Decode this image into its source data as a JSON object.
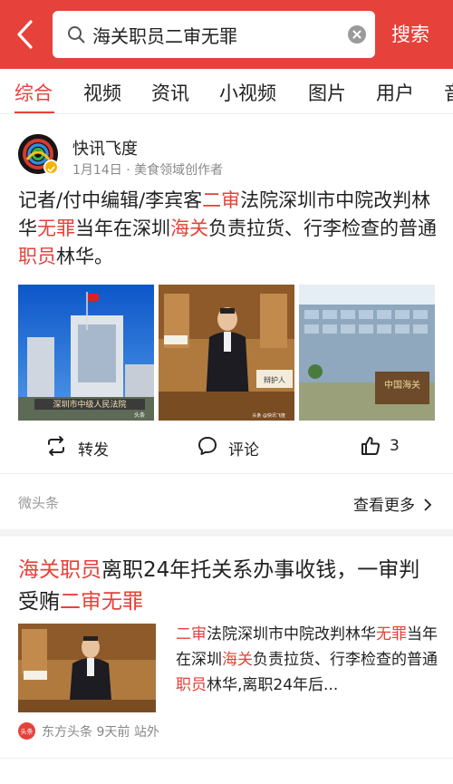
{
  "search": {
    "query": "海关职员二审无罪",
    "button_label": "搜索"
  },
  "tabs": [
    "综合",
    "视频",
    "资讯",
    "小视频",
    "图片",
    "用户",
    "音"
  ],
  "active_tab": "综合",
  "card1": {
    "author": "快讯飞度",
    "date": "1月14日",
    "separator": "·",
    "author_tag": "美食领域创作者",
    "headline_parts": [
      {
        "t": "记者/付中编辑/李宾客",
        "hl": false
      },
      {
        "t": "二审",
        "hl": true
      },
      {
        "t": "法院深圳市中院改判林华",
        "hl": false
      },
      {
        "t": "无罪",
        "hl": true
      },
      {
        "t": "当年在深圳",
        "hl": false
      },
      {
        "t": "海关",
        "hl": true
      },
      {
        "t": "负责拉货、行李检查的普通",
        "hl": false
      },
      {
        "t": "职员",
        "hl": true
      },
      {
        "t": "林华。",
        "hl": false
      }
    ],
    "images": [
      {
        "caption": "深圳市中级人民法院",
        "watermark": "头条"
      },
      {
        "caption": "辩护人",
        "watermark": "头条 @快讯飞度"
      },
      {
        "caption": "中国海关",
        "watermark": ""
      }
    ],
    "actions": {
      "repost": "转发",
      "comment": "评论",
      "like_count": "3"
    },
    "source_label": "微头条",
    "see_more": "查看更多"
  },
  "card2": {
    "title_parts": [
      {
        "t": "海关职员",
        "hl": true
      },
      {
        "t": "离职24年托关系办事收钱，一审判受贿",
        "hl": false
      },
      {
        "t": "二审无罪",
        "hl": true
      }
    ],
    "snippet_parts": [
      {
        "t": "二审",
        "hl": true
      },
      {
        "t": "法院深圳市中院改判林华",
        "hl": false
      },
      {
        "t": "无罪",
        "hl": true
      },
      {
        "t": "当年在深圳",
        "hl": false
      },
      {
        "t": "海关",
        "hl": true
      },
      {
        "t": "负责拉货、行李检查的普通",
        "hl": false
      },
      {
        "t": "职员",
        "hl": true
      },
      {
        "t": "林华,离职24年后...",
        "hl": false
      }
    ],
    "source": "东方头条",
    "time": "9天前",
    "site_tag": "站外",
    "source_icon_text": "头条"
  },
  "colors": {
    "accent": "#e6413a",
    "muted": "#888888"
  },
  "icons": [
    "back-arrow-icon",
    "search-icon",
    "clear-icon",
    "repost-icon",
    "comment-icon",
    "like-icon",
    "chevron-right-icon"
  ]
}
